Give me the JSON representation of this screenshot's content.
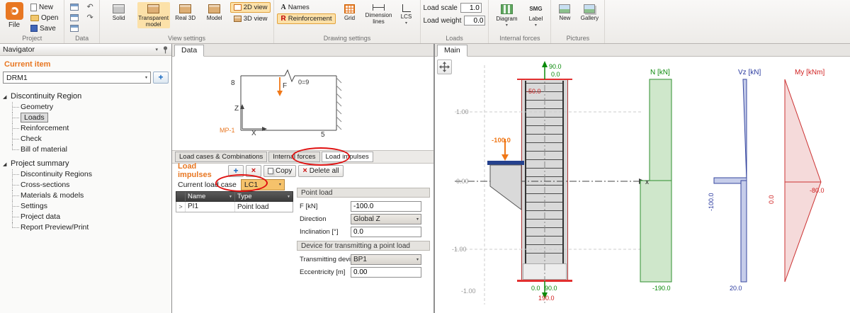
{
  "icons": {
    "tree_expanded": "◢",
    "dropdown_arrow": "▾",
    "filter": "▼",
    "row_expander": ">",
    "add": "+",
    "delete": "×",
    "undo": "↶",
    "redo": "↷",
    "names_glyph": "A",
    "reinforcement_glyph": "R",
    "label_glyph": "SMG"
  },
  "colors": {
    "accent": "#e87722",
    "n_diagram": "#2f8f2f",
    "vz_diagram": "#37479f",
    "my_diagram": "#cc3333",
    "load_orange": "#f07818",
    "annotation": "#e01010"
  },
  "ribbon": {
    "file_label": "File",
    "new_label": "New",
    "open_label": "Open",
    "save_label": "Save",
    "groups": {
      "project": "Project",
      "data": "Data",
      "view_settings": "View settings",
      "drawing_settings": "Drawing settings",
      "loads": "Loads",
      "internal_forces": "Internal forces",
      "pictures": "Pictures"
    },
    "view": {
      "solid": "Solid",
      "transparent": "Transparent model",
      "real3d": "Real 3D",
      "model": "Model",
      "view2d": "2D view",
      "view3d": "3D view"
    },
    "drawing": {
      "names": "Names",
      "reinforcement": "Reinforcement",
      "grid": "Grid",
      "dimension_lines": "Dimension lines",
      "lcs": "LCS"
    },
    "loads": {
      "scale_label": "Load scale",
      "scale_value": "1.0",
      "weight_label": "Load weight",
      "weight_value": "0.0"
    },
    "internal_forces": {
      "diagram": "Diagram",
      "label": "Label"
    },
    "pictures": {
      "new": "New",
      "gallery": "Gallery"
    }
  },
  "navigator": {
    "title": "Navigator",
    "current_item_label": "Current item",
    "current_item": "DRM1",
    "sections": [
      {
        "label": "Discontinuity Region",
        "children": [
          "Geometry",
          "Loads",
          "Reinforcement",
          "Check",
          "Bill of material"
        ]
      },
      {
        "label": "Project summary",
        "children": [
          "Discontinuity Regions",
          "Cross-sections",
          "Materials & models",
          "Settings",
          "Project data",
          "Report Preview/Print"
        ]
      }
    ]
  },
  "data_panel": {
    "tab": "Data",
    "schematic": {
      "node_top_left": "8",
      "force_label": "F",
      "node_top_right": "0=9",
      "node_bottom_right": "5",
      "member_label": "MP-1",
      "axis_v": "Z",
      "axis_h": "X"
    },
    "tabs": [
      "Load cases & Combinations",
      "Internal forces",
      "Load impulses"
    ],
    "section_title": "Load impulses",
    "copy_label": "Copy",
    "delete_all_label": "Delete all",
    "current_load_case_label": "Current load case",
    "current_load_case": "LC1",
    "table": {
      "col_name": "Name",
      "col_type": "Type",
      "rows": [
        {
          "name": "PI1",
          "type": "Point load"
        }
      ]
    },
    "properties": {
      "group_point_load": "Point load",
      "f_label": "F [kN]",
      "f_value": "-100.0",
      "direction_label": "Direction",
      "direction_value": "Global Z",
      "inclination_label": "Inclination [°]",
      "inclination_value": "0.0",
      "group_device": "Device for transmitting a point load",
      "device_label": "Transmitting device",
      "device_value": "BP1",
      "eccentricity_label": "Eccentricity [m]",
      "eccentricity_value": "0.00"
    }
  },
  "main_panel": {
    "tab": "Main",
    "ruler": {
      "r1": "1.00",
      "r0": "0.00",
      "rm1": "-1.00",
      "rbottom": "-1.00"
    },
    "structure": {
      "axis_x_label": "x",
      "top_value_1": "90.0",
      "top_value_2": "0.0",
      "top_value_red": "-50.0",
      "applied_load": "-100.0",
      "bottom_value_1": "0.0",
      "bottom_value_2": "90.0",
      "bottom_value_red": "190.0"
    },
    "diagrams": [
      {
        "title": "N [kN]",
        "value_bottom": "-190.0"
      },
      {
        "title": "Vz [kN]",
        "value_mid": "-100.0",
        "value_bottom": "20.0"
      },
      {
        "title": "My [kNm]",
        "value_axis": "0.0",
        "value_peak": "-80.0"
      }
    ]
  }
}
